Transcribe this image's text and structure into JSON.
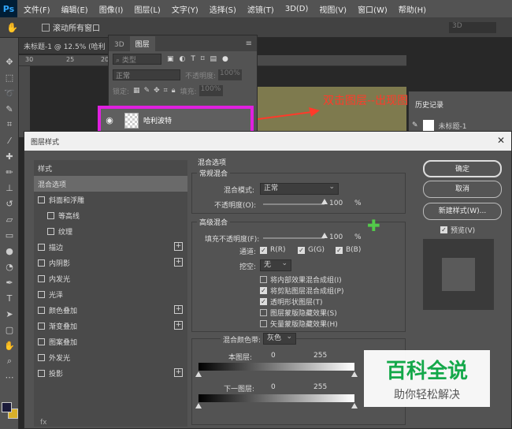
{
  "app": {
    "logo": "Ps"
  },
  "menu": [
    "文件(F)",
    "编辑(E)",
    "图像(I)",
    "图层(L)",
    "文字(Y)",
    "选择(S)",
    "滤镜(T)",
    "3D(D)",
    "视图(V)",
    "窗口(W)",
    "帮助(H)"
  ],
  "options_bar": {
    "scroll_all_label": "滚动所有窗口",
    "mode_3d": "3D"
  },
  "document_tab": "未标题-1 @ 12.5% (哈利",
  "ruler_ticks": [
    "30",
    "25",
    "20"
  ],
  "annotation": "双击图层--出现图层样式",
  "history_panel": {
    "title": "历史记录",
    "item": "未标题-1"
  },
  "layers_panel": {
    "tabs": [
      "3D",
      "图层"
    ],
    "filter_kind": "类型",
    "blend_mode": "正常",
    "opacity_label": "不透明度:",
    "opacity_value": "100%",
    "lock_label": "锁定:",
    "fill_label": "填充:",
    "fill_value": "100%",
    "layer_name": "哈利波特"
  },
  "dialog": {
    "title": "图层样式",
    "styles_list": [
      {
        "label": "样式",
        "checkbox": false,
        "plus": false,
        "indent": 0,
        "active": false
      },
      {
        "label": "混合选项",
        "checkbox": false,
        "plus": false,
        "indent": 0,
        "active": true
      },
      {
        "label": "斜面和浮雕",
        "checkbox": true,
        "plus": false,
        "indent": 0,
        "active": false
      },
      {
        "label": "等高线",
        "checkbox": true,
        "plus": false,
        "indent": 1,
        "active": false
      },
      {
        "label": "纹理",
        "checkbox": true,
        "plus": false,
        "indent": 1,
        "active": false
      },
      {
        "label": "描边",
        "checkbox": true,
        "plus": true,
        "indent": 0,
        "active": false
      },
      {
        "label": "内阴影",
        "checkbox": true,
        "plus": true,
        "indent": 0,
        "active": false
      },
      {
        "label": "内发光",
        "checkbox": true,
        "plus": false,
        "indent": 0,
        "active": false
      },
      {
        "label": "光泽",
        "checkbox": true,
        "plus": false,
        "indent": 0,
        "active": false
      },
      {
        "label": "颜色叠加",
        "checkbox": true,
        "plus": true,
        "indent": 0,
        "active": false
      },
      {
        "label": "渐变叠加",
        "checkbox": true,
        "plus": true,
        "indent": 0,
        "active": false
      },
      {
        "label": "图案叠加",
        "checkbox": true,
        "plus": false,
        "indent": 0,
        "active": false
      },
      {
        "label": "外发光",
        "checkbox": true,
        "plus": false,
        "indent": 0,
        "active": false
      },
      {
        "label": "投影",
        "checkbox": true,
        "plus": true,
        "indent": 0,
        "active": false
      }
    ],
    "footer_fx": "fx",
    "blend_options_title": "混合选项",
    "general_blending": {
      "legend": "常规混合",
      "blend_mode_label": "混合模式:",
      "blend_mode_value": "正常",
      "opacity_label": "不透明度(O):",
      "opacity_value": "100",
      "opacity_fraction": 1.0,
      "pct": "%"
    },
    "advanced_blending": {
      "legend": "高级混合",
      "fill_opacity_label": "填充不透明度(F):",
      "fill_opacity_value": "100",
      "fill_opacity_fraction": 1.0,
      "pct": "%",
      "channels_label": "通道:",
      "channel_r": "R(R)",
      "channel_g": "G(G)",
      "channel_b": "B(B)",
      "knockout_label": "挖空:",
      "knockout_value": "无",
      "options": [
        {
          "label": "将内部效果混合成组(I)",
          "checked": false
        },
        {
          "label": "将剪贴图层混合成组(P)",
          "checked": true
        },
        {
          "label": "透明形状图层(T)",
          "checked": true
        },
        {
          "label": "图层蒙版隐藏效果(S)",
          "checked": false
        },
        {
          "label": "矢量蒙版隐藏效果(H)",
          "checked": false
        }
      ]
    },
    "blend_if": {
      "label": "混合颜色带:",
      "value": "灰色",
      "this_layer_label": "本图层:",
      "this_layer_min": "0",
      "this_layer_max": "255",
      "underlying_label": "下一图层:",
      "underlying_min": "0",
      "underlying_max": "255"
    },
    "buttons": {
      "ok": "确定",
      "cancel": "取消",
      "new_style": "新建样式(W)...",
      "preview": "预览(V)"
    }
  },
  "watermark": {
    "main": "百科全说",
    "sub": "助你轻松解决"
  },
  "colors": {
    "highlight": "#e020e0",
    "annotation": "#ff3a2a",
    "watermark_green": "#14a84a"
  }
}
